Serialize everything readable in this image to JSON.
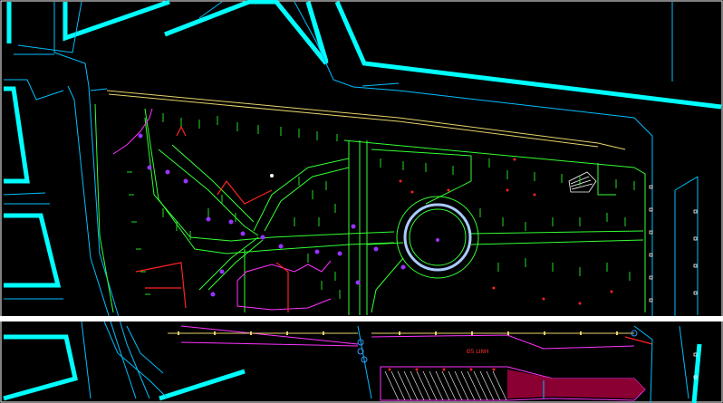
{
  "drawing": {
    "background_color": "#000000",
    "colors": {
      "road_cyan": "#00ffff",
      "curb_thin": "#00bfff",
      "vegetation_green": "#22dd22",
      "paths_green": "#33ff33",
      "markers_purple": "#9933ff",
      "utility_red": "#ff2222",
      "lines_magenta": "#ff33ff",
      "rail_yellow": "#e6d36a",
      "parking_fill": "#8b0032",
      "divider_white": "#ffffff"
    },
    "labels": {
      "street_name": "Đ5 LINH"
    }
  }
}
